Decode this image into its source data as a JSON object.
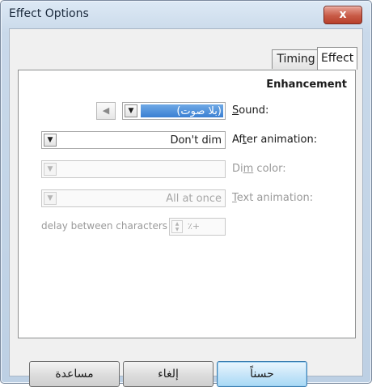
{
  "window": {
    "title": "Effect Options",
    "close_label": "x"
  },
  "tabs": [
    {
      "label": "Timing",
      "active": false
    },
    {
      "label": "Effect",
      "active": true
    }
  ],
  "enhancement": {
    "title": "Enhancement",
    "sound": {
      "label_prefix": "S",
      "label_rest": "ound:",
      "value": "(بلا صوت)"
    },
    "after_animation": {
      "label_prefix": "Af",
      "label_u": "t",
      "label_rest": "er animation:",
      "value": "Don't dim"
    },
    "dim_color": {
      "label_prefix": "Di",
      "label_u": "m",
      "label_rest": " color:",
      "value": ""
    },
    "text_animation": {
      "label_u": "T",
      "label_rest": "ext animation:",
      "value": "All at once"
    },
    "delay": {
      "label": "delay between characters",
      "value": "٪+"
    }
  },
  "buttons": {
    "ok": "حسناً",
    "cancel": "إلغاء",
    "help": "مساعدة"
  },
  "icons": {
    "dropdown": "▼",
    "prev_sound": "◀"
  }
}
